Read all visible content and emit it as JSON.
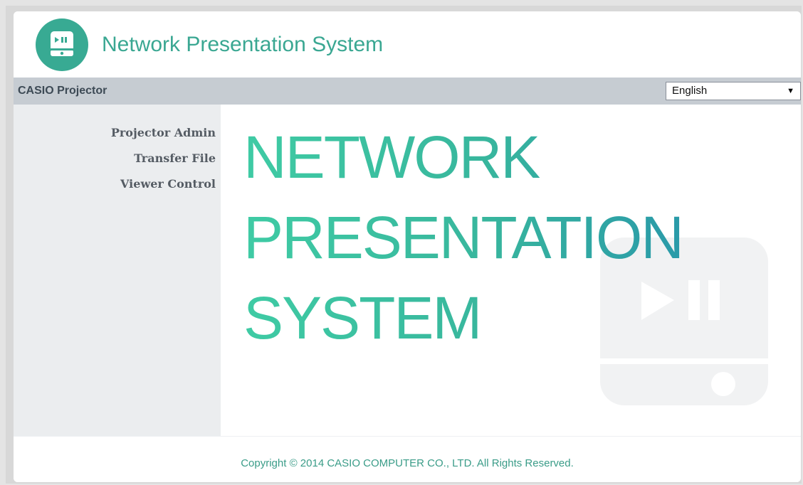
{
  "header": {
    "app_title": "Network Presentation System",
    "logo_icon": "play-pause-monitor-icon"
  },
  "topbar": {
    "brand": "CASIO Projector",
    "language": {
      "selected": "English"
    }
  },
  "sidebar": {
    "items": [
      {
        "label": "Projector Admin"
      },
      {
        "label": "Transfer File"
      },
      {
        "label": "Viewer Control"
      }
    ]
  },
  "hero": {
    "lines": [
      "NETWORK",
      "PRESENTATION",
      "SYSTEM"
    ]
  },
  "footer": {
    "copyright": "Copyright © 2014 CASIO COMPUTER CO., LTD. All Rights Reserved."
  },
  "colors": {
    "accent": "#38aa93",
    "topbar": "#c6ccd2",
    "sidebar": "#ebedef"
  }
}
